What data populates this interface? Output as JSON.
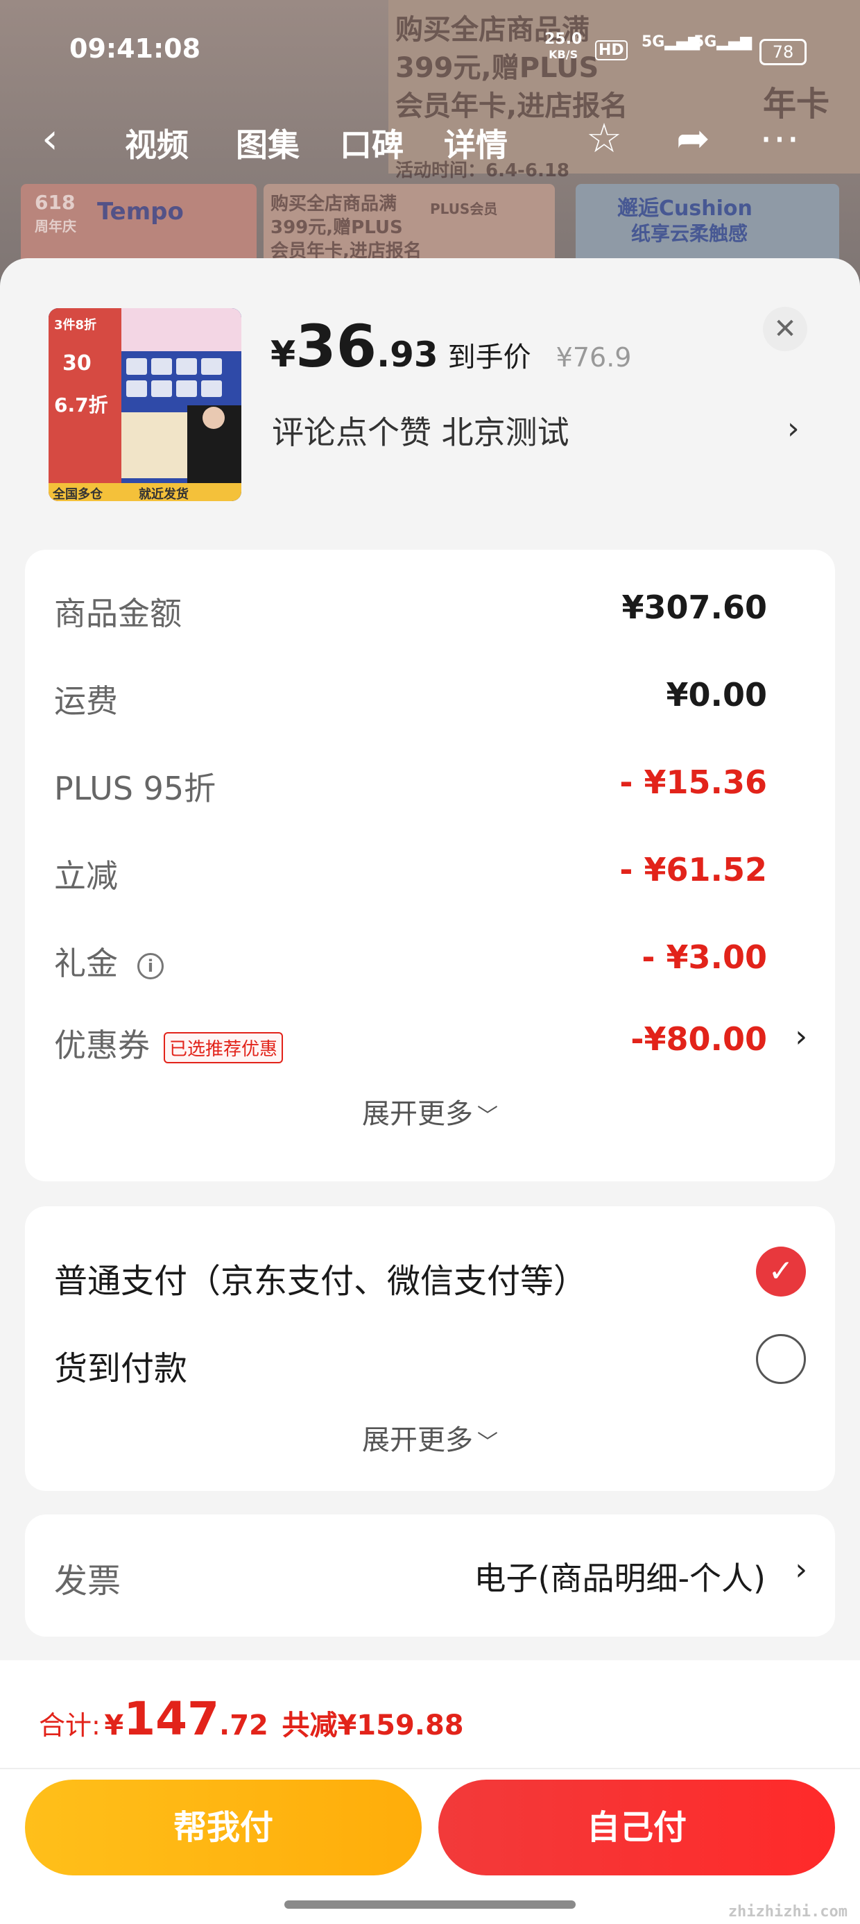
{
  "status_bar": {
    "time": "09:41:08",
    "net_speed_value": "25.0",
    "net_speed_unit": "KB/S",
    "hd_label": "HD",
    "signal_1": "5G",
    "signal_2": "5G",
    "battery": "78"
  },
  "background_nav": {
    "tabs": [
      "视频",
      "图集",
      "口碑",
      "详情"
    ],
    "banner_text_1": "购买全店商品满",
    "banner_text_2": "399元,赠PLUS",
    "banner_text_3": "会员年卡,进店报名",
    "banner_event": "活动时间：6.4-6.18",
    "banner_brand": "Tempo",
    "banner_618": "618",
    "banner_anniv": "周年庆",
    "banner_plus": "PLUS会员",
    "banner_year_card": "年卡",
    "banner_cushion": "邂逅Cushion",
    "banner_cushion_sub": "纸享云柔触感"
  },
  "product": {
    "thumb_badge_1": "3件8折",
    "thumb_badge_2": "30",
    "thumb_badge_3": "6.7折",
    "thumb_footer_left": "全国多仓",
    "thumb_footer_right": "就近发货",
    "price_symbol": "¥",
    "price_int": "36",
    "price_dec": ".93",
    "price_label": "到手价",
    "original_price": "¥76.9",
    "spec": "评论点个赞  北京测试"
  },
  "fees": {
    "rows": [
      {
        "label": "商品金额",
        "value": "¥307.60"
      },
      {
        "label": "运费",
        "value": "¥0.00"
      },
      {
        "label": "PLUS 95折",
        "value": "- ¥15.36"
      },
      {
        "label": "立减",
        "value": "- ¥61.52"
      },
      {
        "label": "礼金",
        "value": "- ¥3.00"
      },
      {
        "label": "优惠券",
        "value": "-¥80.00",
        "tag": "已选推荐优惠"
      }
    ],
    "expand_more": "展开更多"
  },
  "payment": {
    "options": [
      {
        "label": "普通支付（京东支付、微信支付等）",
        "selected": true
      },
      {
        "label": "货到付款",
        "selected": false
      }
    ],
    "expand_more": "展开更多"
  },
  "invoice": {
    "label": "发票",
    "value": "电子(商品明细-个人)"
  },
  "footer": {
    "total_label": "合计:",
    "total_symbol": "¥",
    "total_int": "147",
    "total_dec": ".72",
    "total_saving": "共减¥159.88",
    "btn_help_pay": "帮我付",
    "btn_self_pay": "自己付",
    "watermark": "zhizhizhi.com"
  },
  "colors": {
    "accent_red": "#e2231a",
    "help_button_yellow": "#ffb612",
    "self_button_red": "#f5302f"
  }
}
